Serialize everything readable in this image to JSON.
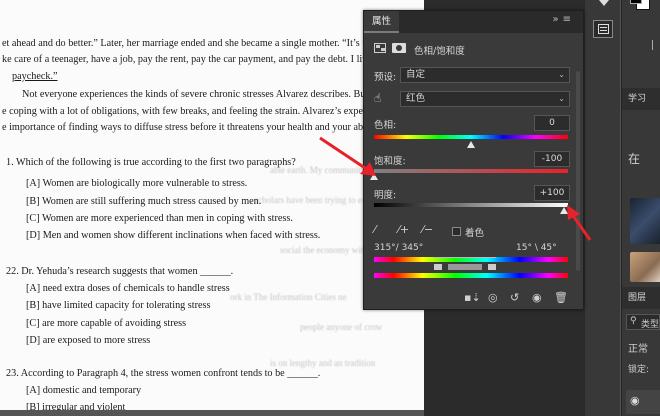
{
  "document": {
    "lines": [
      "et ahead and do better.” Later, her marriage ended and she became a single mother. “It’s the",
      "ke care of a teenager, have a job, pay the rent, pay the car payment, and pay the debt. I lived",
      "paycheck.”",
      "Not everyone experiences the kinds of severe chronic stresses Alvarez describes. But mo",
      "e coping with a lot of obligations, with few breaks, and feeling the strain. Alvarez’s experien",
      "e importance of finding ways to diffuse stress before it threatens your health and your abilit"
    ],
    "q1": {
      "stem": "1.   Which of the following is true according to the first two paragraphs?",
      "options": [
        "[A] Women are biologically more vulnerable to stress.",
        "[B] Women are still suffering much stress caused by men.",
        "[C] Women are more experienced than men in coping with stress.",
        "[D] Men and women show different inclinations when faced with stress."
      ]
    },
    "q2": {
      "stem": "22.  Dr. Yehuda’s research suggests that women ______.",
      "options": [
        "[A] need extra doses of chemicals to handle stress",
        "[B] have limited capacity for tolerating stress",
        "[C] are more capable of avoiding stress",
        "[D] are exposed to more stress"
      ]
    },
    "q3": {
      "stem": "23.  According to Paragraph 4, the stress women confront tends to be ______.",
      "options": [
        "[A] domestic and temporary",
        "[B] irregular and violent"
      ]
    }
  },
  "properties": {
    "tab_title": "属性",
    "panel_icon_label": "色相/饱和度",
    "preset_label": "预设:",
    "preset_value": "自定",
    "channel_value": "红色",
    "hue_label": "色相:",
    "hue_value": "0",
    "saturation_label": "饱和度:",
    "saturation_value": "-100",
    "lightness_label": "明度:",
    "lightness_value": "+100",
    "colorize_label": "着色",
    "range_left": "315°/ 345°",
    "range_right": "15° \\ 45°",
    "colors": {
      "accent_red": "#e8222a"
    }
  },
  "right_panel": {
    "learn_tab": "学习",
    "learn_text": "在",
    "layers_tab": "图层",
    "search_label": "类型",
    "blend_mode": "正常",
    "lock_label": "锁定:"
  }
}
